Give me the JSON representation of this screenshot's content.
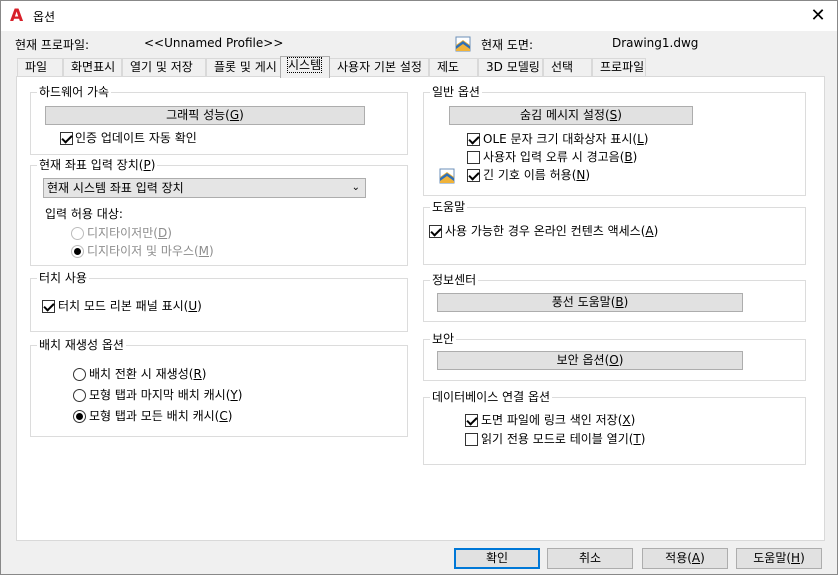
{
  "window": {
    "title": "옵션",
    "close_glyph": "✕",
    "app_icon_glyph": "A",
    "accent_color": "#d8202a"
  },
  "profile": {
    "current_profile_label": "현재 프로파일:",
    "current_profile_value": "<<Unnamed Profile>>",
    "current_drawing_label": "현재 도면:",
    "current_drawing_value": "Drawing1.dwg"
  },
  "tabs": [
    {
      "label": "파일"
    },
    {
      "label": "화면표시"
    },
    {
      "label": "열기 및 저장"
    },
    {
      "label": "플롯 및 게시"
    },
    {
      "label": "시스템",
      "active": true
    },
    {
      "label": "사용자 기본 설정"
    },
    {
      "label": "제도"
    },
    {
      "label": "3D 모델링"
    },
    {
      "label": "선택"
    },
    {
      "label": "프로파일"
    }
  ],
  "hardware": {
    "title": "하드웨어 가속",
    "graphics_button": "그래픽 성능(",
    "graphics_key": "G",
    "cert_update": "인증 업데이트 자동 확인"
  },
  "pointing": {
    "title": "현재 좌표 입력 장치(",
    "title_key": "P",
    "device_value": "현재 시스템 좌표 입력 장치",
    "accept_input_label": "입력 허용 대상:",
    "digitizer_only": "디지타이저만(",
    "digitizer_only_key": "D",
    "digitizer_mouse": "디지타이저 및 마우스(",
    "digitizer_mouse_key": "M"
  },
  "touch": {
    "title": "터치 사용",
    "ribbon_label": "터치 모드 리본 패널 표시(",
    "ribbon_key": "U"
  },
  "layout_regen": {
    "title": "배치 재생성 옵션",
    "opt1": "배치 전환 시 재생성(",
    "opt1_key": "R",
    "opt2": "모형 탭과 마지막 배치 캐시(",
    "opt2_key": "Y",
    "opt3": "모형 탭과 모든 배치 캐시(",
    "opt3_key": "C"
  },
  "general": {
    "title": "일반 옵션",
    "hidden_msg_button": "숨김 메시지 설정(",
    "hidden_msg_key": "S",
    "ole_label": "OLE 문자 크기 대화상자 표시(",
    "ole_key": "L",
    "beep_label": "사용자 입력 오류 시 경고음(",
    "beep_key": "B",
    "long_names_label": "긴 기호 이름 허용(",
    "long_names_key": "N"
  },
  "help": {
    "title": "도움말",
    "online_label": "사용 가능한 경우 온라인 컨텐츠 액세스(",
    "online_key": "A"
  },
  "infocenter": {
    "title": "정보센터",
    "balloon_button": "풍선 도움말(",
    "balloon_key": "B"
  },
  "security": {
    "title": "보안",
    "security_button": "보안 옵션(",
    "security_key": "O"
  },
  "dbconnect": {
    "title": "데이터베이스 연결 옵션",
    "store_links_label": "도면 파일에 링크 색인 저장(",
    "store_links_key": "X",
    "readonly_label": "읽기 전용 모드로 테이블 열기(",
    "readonly_key": "T"
  },
  "buttons": {
    "ok": "확인",
    "cancel": "취소",
    "apply": "적용(",
    "apply_key": "A",
    "help": "도움말(",
    "help_key": "H"
  },
  "close_paren": ")"
}
